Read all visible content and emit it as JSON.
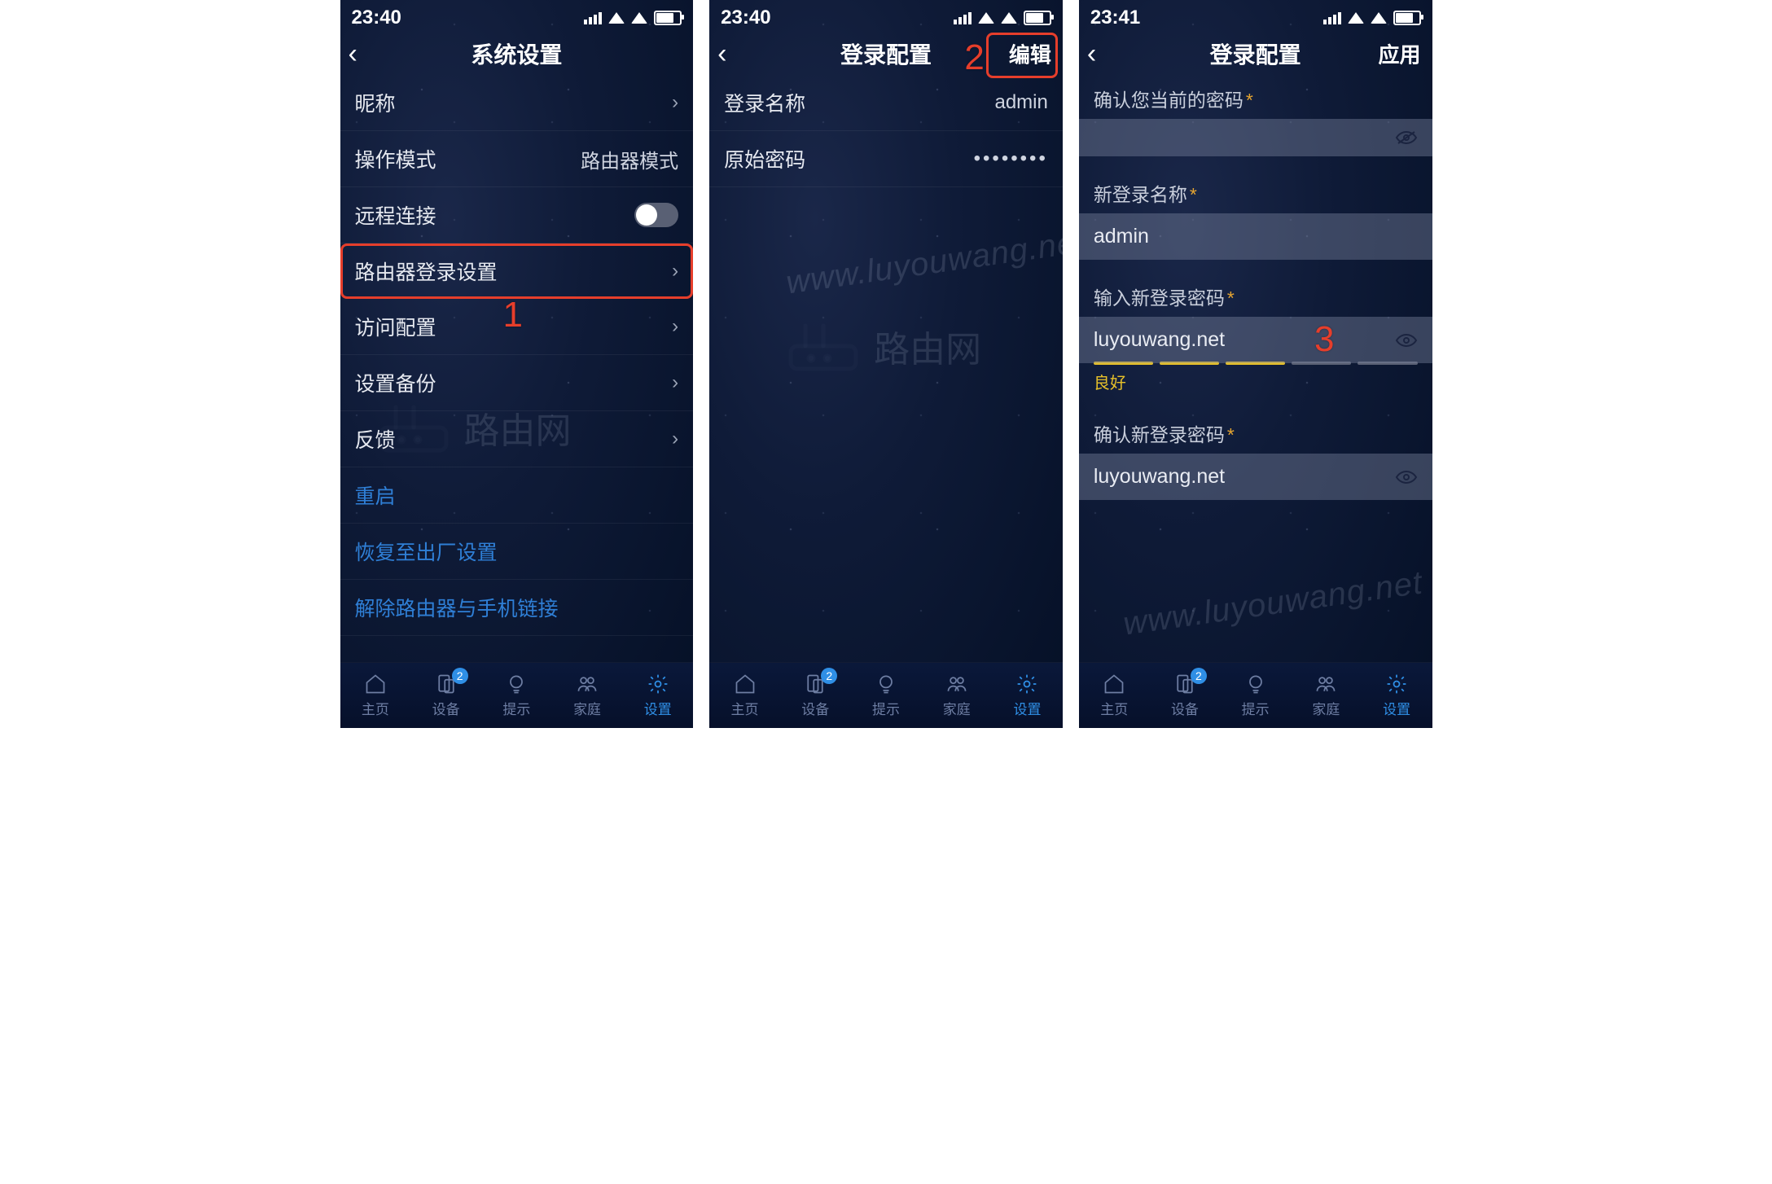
{
  "status": {
    "time1": "23:40",
    "time2": "23:40",
    "time3": "23:41"
  },
  "annotations": {
    "step1": "1",
    "step2": "2",
    "step3": "3"
  },
  "watermark": {
    "text": "路由网",
    "url": "www.luyouwang.net"
  },
  "tabbar": {
    "home": "主页",
    "devices": "设备",
    "tips": "提示",
    "family": "家庭",
    "settings": "设置",
    "badge": "2"
  },
  "screen1": {
    "title": "系统设置",
    "rows": {
      "nickname": "昵称",
      "mode_label": "操作模式",
      "mode_value": "路由器模式",
      "remote": "远程连接",
      "login": "路由器登录设置",
      "access": "访问配置",
      "backup": "设置备份",
      "feedback": "反馈",
      "reboot": "重启",
      "factory": "恢复至出厂设置",
      "unlink": "解除路由器与手机链接"
    }
  },
  "screen2": {
    "title": "登录配置",
    "action": "编辑",
    "login_name_label": "登录名称",
    "login_name_value": "admin",
    "orig_pw_label": "原始密码",
    "orig_pw_value": "••••••••"
  },
  "screen3": {
    "title": "登录配置",
    "action": "应用",
    "confirm_current": "确认您当前的密码",
    "new_login": "新登录名称",
    "new_login_value": "admin",
    "new_pw": "输入新登录密码",
    "new_pw_value": "luyouwang.net",
    "strength": "良好",
    "confirm_pw": "确认新登录密码",
    "confirm_pw_value": "luyouwang.net"
  }
}
